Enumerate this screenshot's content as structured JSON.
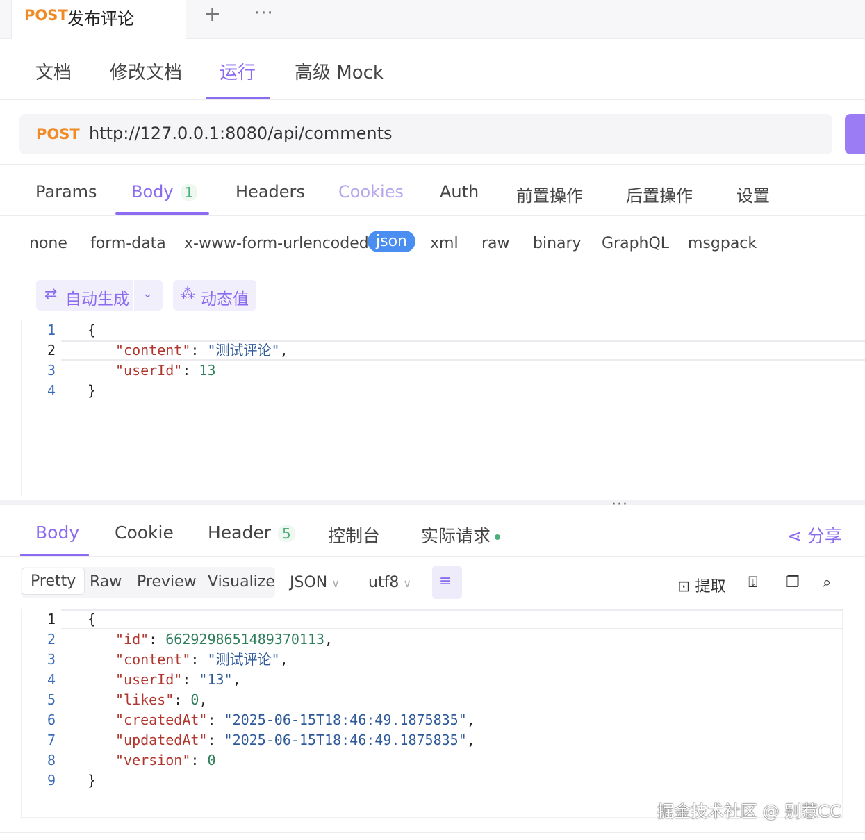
{
  "top_tab": {
    "method": "POST",
    "title": "发布评论",
    "plus_icon": "+",
    "more_icon": "···"
  },
  "main_tabs": [
    "文档",
    "修改文档",
    "运行",
    "高级 Mock"
  ],
  "request": {
    "method": "POST",
    "url": "http://127.0.0.1:8080/api/comments"
  },
  "request_tabs": {
    "params": "Params",
    "body": "Body",
    "body_count": "1",
    "headers": "Headers",
    "cookies": "Cookies",
    "auth": "Auth",
    "pre": "前置操作",
    "post": "后置操作",
    "settings": "设置"
  },
  "body_types": [
    "none",
    "form-data",
    "x-www-form-urlencoded",
    "json",
    "xml",
    "raw",
    "binary",
    "GraphQL",
    "msgpack"
  ],
  "gen": {
    "auto_label": "自动生成",
    "dynamic_label": "动态值"
  },
  "request_body": {
    "line_numbers": [
      "1",
      "2",
      "3",
      "4"
    ],
    "open": "{",
    "content_key": "\"content\"",
    "content_value": "\"测试评论\"",
    "userid_key": "\"userId\"",
    "userid_value": "13",
    "close": "}"
  },
  "response_tabs": {
    "body": "Body",
    "cookie": "Cookie",
    "header": "Header",
    "header_count": "5",
    "console": "控制台",
    "actual": "实际请求",
    "share": "分享"
  },
  "view": {
    "modes": [
      "Pretty",
      "Raw",
      "Preview",
      "Visualize"
    ],
    "format": "JSON",
    "encoding": "utf8",
    "extract": "提取"
  },
  "response_body": {
    "line_numbers": [
      "1",
      "2",
      "3",
      "4",
      "5",
      "6",
      "7",
      "8",
      "9"
    ],
    "open": "{",
    "id_key": "\"id\"",
    "id_value": "6629298651489370113",
    "content_key": "\"content\"",
    "content_value": "\"测试评论\"",
    "userid_key": "\"userId\"",
    "userid_value": "\"13\"",
    "likes_key": "\"likes\"",
    "likes_value": "0",
    "created_key": "\"createdAt\"",
    "created_value": "\"2025-06-15T18:46:49.1875835\"",
    "updated_key": "\"updatedAt\"",
    "updated_value": "\"2025-06-15T18:46:49.1875835\"",
    "version_key": "\"version\"",
    "version_value": "0",
    "close": "}"
  },
  "watermark": "掘金技术社区 @ 别惹CC",
  "colors": {
    "accent": "#8b6cf0",
    "method": "#f08a24",
    "json_active": "#4a8ef2",
    "count_green": "#4caf7a"
  }
}
